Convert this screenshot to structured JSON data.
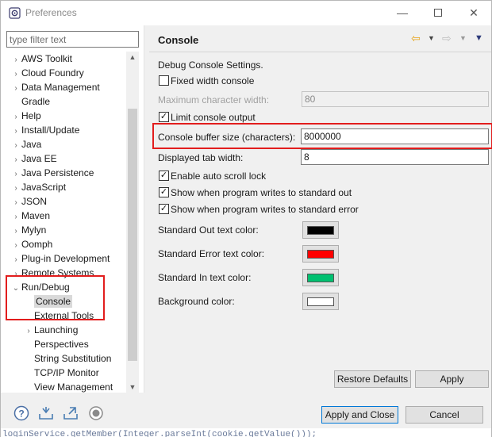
{
  "window": {
    "title": "Preferences"
  },
  "filter": {
    "placeholder": "type filter text"
  },
  "tree": [
    {
      "label": "AWS Toolkit",
      "arrow": "›",
      "level": 0
    },
    {
      "label": "Cloud Foundry",
      "arrow": "›",
      "level": 0
    },
    {
      "label": "Data Management",
      "arrow": "›",
      "level": 0
    },
    {
      "label": "Gradle",
      "arrow": "",
      "level": 0
    },
    {
      "label": "Help",
      "arrow": "›",
      "level": 0
    },
    {
      "label": "Install/Update",
      "arrow": "›",
      "level": 0
    },
    {
      "label": "Java",
      "arrow": "›",
      "level": 0
    },
    {
      "label": "Java EE",
      "arrow": "›",
      "level": 0
    },
    {
      "label": "Java Persistence",
      "arrow": "›",
      "level": 0
    },
    {
      "label": "JavaScript",
      "arrow": "›",
      "level": 0
    },
    {
      "label": "JSON",
      "arrow": "›",
      "level": 0
    },
    {
      "label": "Maven",
      "arrow": "›",
      "level": 0
    },
    {
      "label": "Mylyn",
      "arrow": "›",
      "level": 0
    },
    {
      "label": "Oomph",
      "arrow": "›",
      "level": 0
    },
    {
      "label": "Plug-in Development",
      "arrow": "›",
      "level": 0
    },
    {
      "label": "Remote Systems",
      "arrow": "›",
      "level": 0
    },
    {
      "label": "Run/Debug",
      "arrow": "⌄",
      "level": 0
    },
    {
      "label": "Console",
      "arrow": "",
      "level": 1,
      "selected": true
    },
    {
      "label": "External Tools",
      "arrow": "",
      "level": 1
    },
    {
      "label": "Launching",
      "arrow": "›",
      "level": 1
    },
    {
      "label": "Perspectives",
      "arrow": "",
      "level": 1
    },
    {
      "label": "String Substitution",
      "arrow": "",
      "level": 1
    },
    {
      "label": "TCP/IP Monitor",
      "arrow": "",
      "level": 1
    },
    {
      "label": "View Management",
      "arrow": "",
      "level": 1
    }
  ],
  "page": {
    "title": "Console",
    "intro": "Debug Console Settings.",
    "fixed_width": {
      "label": "Fixed width console",
      "checked": false
    },
    "max_char_width": {
      "label": "Maximum character width:",
      "value": "80"
    },
    "limit_output": {
      "label": "Limit console output",
      "checked": true
    },
    "buffer_size": {
      "label": "Console buffer size (characters):",
      "value": "8000000"
    },
    "tab_width": {
      "label": "Displayed tab width:",
      "value": "8"
    },
    "auto_scroll": {
      "label": "Enable auto scroll lock",
      "checked": true
    },
    "show_out": {
      "label": "Show when program writes to standard out",
      "checked": true
    },
    "show_err": {
      "label": "Show when program writes to standard error",
      "checked": true
    },
    "colors": [
      {
        "label": "Standard Out text color:",
        "color": "#000000"
      },
      {
        "label": "Standard Error text color:",
        "color": "#ff0000"
      },
      {
        "label": "Standard In text color:",
        "color": "#00c070"
      },
      {
        "label": "Background color:",
        "color": "#ffffff"
      }
    ],
    "restore_defaults": "Restore Defaults",
    "apply": "Apply"
  },
  "footer": {
    "apply_close": "Apply and Close",
    "cancel": "Cancel",
    "overflow_text": "loginService.getMember(Integer.parseInt(cookie.getValue()));"
  },
  "icons": {
    "app": "preferences-gear-icon",
    "help": "help-icon",
    "import": "import-icon",
    "export": "export-icon",
    "record": "record-icon",
    "back": "back-arrow-icon",
    "forward": "forward-arrow-icon",
    "menu": "view-menu-icon"
  },
  "accent": {
    "highlight": "#e21d1d",
    "default_button": "#0078d7"
  }
}
